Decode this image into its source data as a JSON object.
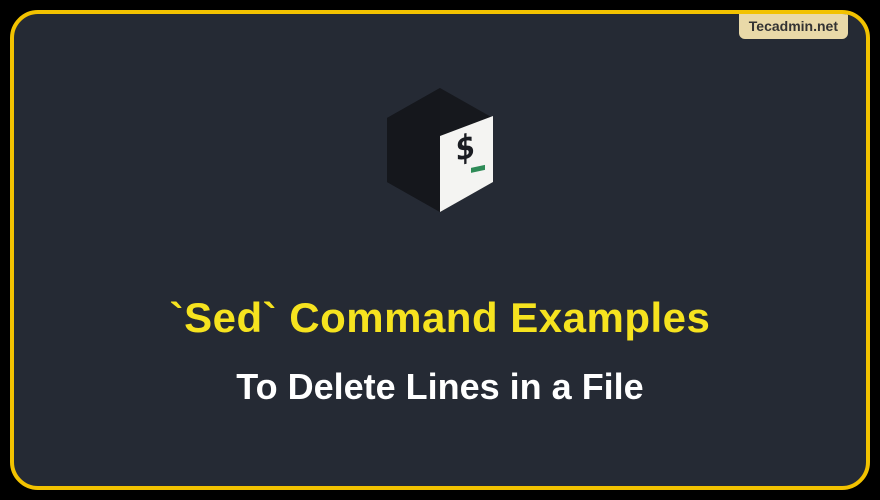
{
  "watermark": {
    "label": "Tecadmin.net"
  },
  "icon": {
    "name": "terminal-cube-icon",
    "prompt_glyph": "$",
    "underscore": "_"
  },
  "headings": {
    "main": "`Sed` Command Examples",
    "sub": "To Delete Lines in a File"
  }
}
